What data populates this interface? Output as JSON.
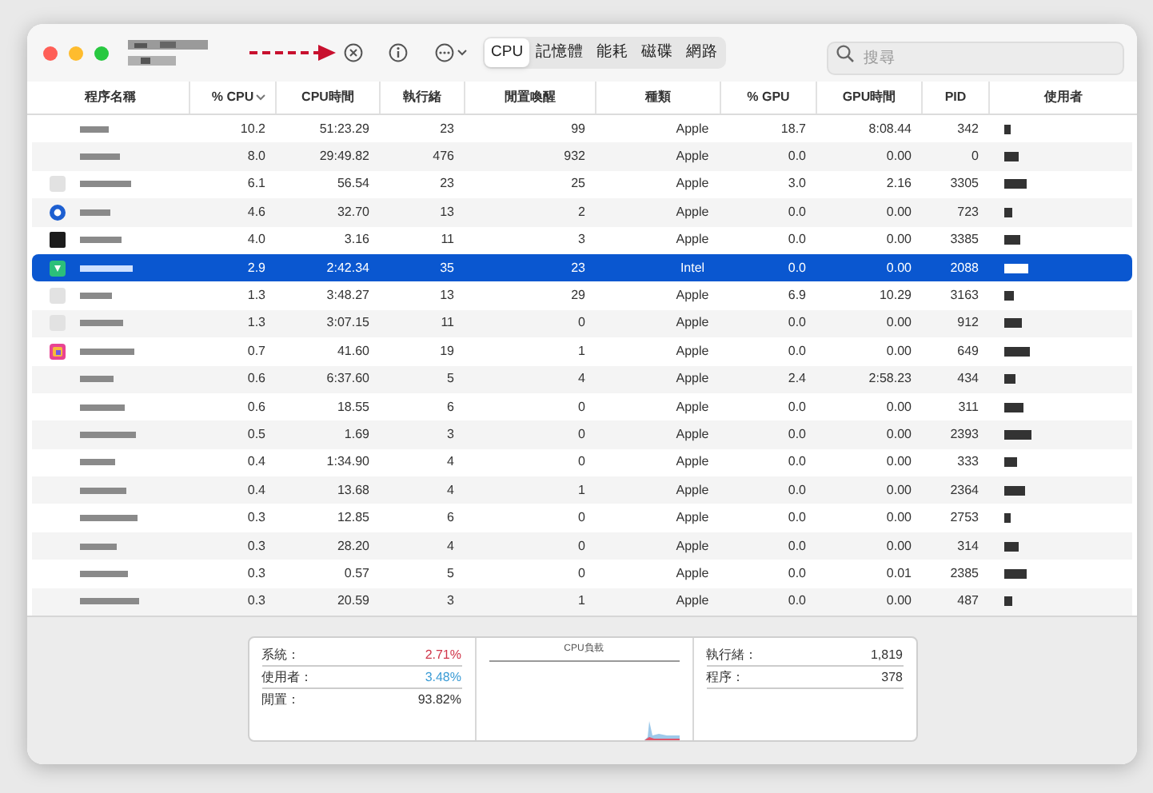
{
  "toolbar": {
    "tabs": [
      {
        "label": "CPU",
        "selected": true
      },
      {
        "label": "記憶體",
        "selected": false
      },
      {
        "label": "能耗",
        "selected": false
      },
      {
        "label": "磁碟",
        "selected": false
      },
      {
        "label": "網路",
        "selected": false
      }
    ],
    "search": {
      "placeholder": "搜尋"
    }
  },
  "table": {
    "columns": [
      "程序名稱",
      "% CPU",
      "CPU時間",
      "執行緒",
      "閒置喚醒",
      "種類",
      "% GPU",
      "GPU時間",
      "PID",
      "使用者"
    ],
    "rows": [
      {
        "cpu": "10.2",
        "cpu_time": "51:23.29",
        "threads": "23",
        "idle_wakeups": "99",
        "kind": "Apple",
        "gpu": "18.7",
        "gpu_time": "8:08.44",
        "pid": "342",
        "selected": false
      },
      {
        "cpu": "8.0",
        "cpu_time": "29:49.82",
        "threads": "476",
        "idle_wakeups": "932",
        "kind": "Apple",
        "gpu": "0.0",
        "gpu_time": "0.00",
        "pid": "0",
        "selected": false
      },
      {
        "cpu": "6.1",
        "cpu_time": "56.54",
        "threads": "23",
        "idle_wakeups": "25",
        "kind": "Apple",
        "gpu": "3.0",
        "gpu_time": "2.16",
        "pid": "3305",
        "selected": false
      },
      {
        "cpu": "4.6",
        "cpu_time": "32.70",
        "threads": "13",
        "idle_wakeups": "2",
        "kind": "Apple",
        "gpu": "0.0",
        "gpu_time": "0.00",
        "pid": "723",
        "selected": false
      },
      {
        "cpu": "4.0",
        "cpu_time": "3.16",
        "threads": "11",
        "idle_wakeups": "3",
        "kind": "Apple",
        "gpu": "0.0",
        "gpu_time": "0.00",
        "pid": "3385",
        "selected": false
      },
      {
        "cpu": "2.9",
        "cpu_time": "2:42.34",
        "threads": "35",
        "idle_wakeups": "23",
        "kind": "Intel",
        "gpu": "0.0",
        "gpu_time": "0.00",
        "pid": "2088",
        "selected": true
      },
      {
        "cpu": "1.3",
        "cpu_time": "3:48.27",
        "threads": "13",
        "idle_wakeups": "29",
        "kind": "Apple",
        "gpu": "6.9",
        "gpu_time": "10.29",
        "pid": "3163",
        "selected": false
      },
      {
        "cpu": "1.3",
        "cpu_time": "3:07.15",
        "threads": "11",
        "idle_wakeups": "0",
        "kind": "Apple",
        "gpu": "0.0",
        "gpu_time": "0.00",
        "pid": "912",
        "selected": false
      },
      {
        "cpu": "0.7",
        "cpu_time": "41.60",
        "threads": "19",
        "idle_wakeups": "1",
        "kind": "Apple",
        "gpu": "0.0",
        "gpu_time": "0.00",
        "pid": "649",
        "selected": false
      },
      {
        "cpu": "0.6",
        "cpu_time": "6:37.60",
        "threads": "5",
        "idle_wakeups": "4",
        "kind": "Apple",
        "gpu": "2.4",
        "gpu_time": "2:58.23",
        "pid": "434",
        "selected": false
      },
      {
        "cpu": "0.6",
        "cpu_time": "18.55",
        "threads": "6",
        "idle_wakeups": "0",
        "kind": "Apple",
        "gpu": "0.0",
        "gpu_time": "0.00",
        "pid": "311",
        "selected": false
      },
      {
        "cpu": "0.5",
        "cpu_time": "1.69",
        "threads": "3",
        "idle_wakeups": "0",
        "kind": "Apple",
        "gpu": "0.0",
        "gpu_time": "0.00",
        "pid": "2393",
        "selected": false
      },
      {
        "cpu": "0.4",
        "cpu_time": "1:34.90",
        "threads": "4",
        "idle_wakeups": "0",
        "kind": "Apple",
        "gpu": "0.0",
        "gpu_time": "0.00",
        "pid": "333",
        "selected": false
      },
      {
        "cpu": "0.4",
        "cpu_time": "13.68",
        "threads": "4",
        "idle_wakeups": "1",
        "kind": "Apple",
        "gpu": "0.0",
        "gpu_time": "0.00",
        "pid": "2364",
        "selected": false
      },
      {
        "cpu": "0.3",
        "cpu_time": "12.85",
        "threads": "6",
        "idle_wakeups": "0",
        "kind": "Apple",
        "gpu": "0.0",
        "gpu_time": "0.00",
        "pid": "2753",
        "selected": false
      },
      {
        "cpu": "0.3",
        "cpu_time": "28.20",
        "threads": "4",
        "idle_wakeups": "0",
        "kind": "Apple",
        "gpu": "0.0",
        "gpu_time": "0.00",
        "pid": "314",
        "selected": false
      },
      {
        "cpu": "0.3",
        "cpu_time": "0.57",
        "threads": "5",
        "idle_wakeups": "0",
        "kind": "Apple",
        "gpu": "0.0",
        "gpu_time": "0.01",
        "pid": "2385",
        "selected": false
      },
      {
        "cpu": "0.3",
        "cpu_time": "20.59",
        "threads": "3",
        "idle_wakeups": "1",
        "kind": "Apple",
        "gpu": "0.0",
        "gpu_time": "0.00",
        "pid": "487",
        "selected": false
      }
    ]
  },
  "summary": {
    "load": [
      {
        "label": "系統：",
        "value": "2.71%",
        "color": "#d0364a"
      },
      {
        "label": "使用者：",
        "value": "3.48%",
        "color": "#3a9bd5"
      },
      {
        "label": "閒置：",
        "value": "93.82%",
        "color": "#333333"
      }
    ],
    "chart_title": "CPU負載",
    "counts": [
      {
        "label": "執行緒：",
        "value": "1,819"
      },
      {
        "label": "程序：",
        "value": "378"
      }
    ]
  }
}
